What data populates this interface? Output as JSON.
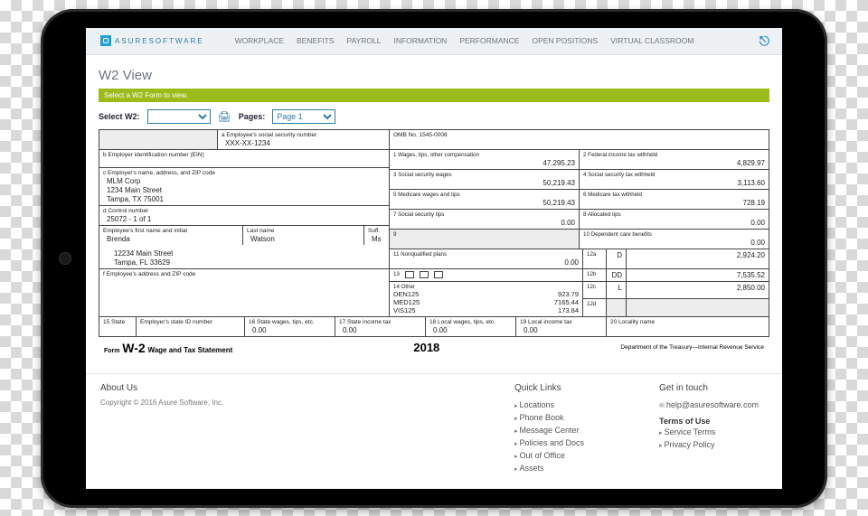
{
  "brand": {
    "name": "ASURESOFTWARE"
  },
  "nav": {
    "items": [
      "WORKPLACE",
      "BENEFITS",
      "PAYROLL",
      "INFORMATION",
      "PERFORMANCE",
      "OPEN POSITIONS",
      "VIRTUAL CLASSROOM"
    ]
  },
  "page": {
    "title": "W2 View",
    "green_bar": "Select a W2 Form to view.",
    "select_w2_label": "Select W2:",
    "select_w2_value": "",
    "pages_label": "Pages:",
    "pages_value": "Page 1"
  },
  "w2": {
    "box_a_label": "a Employee's social security number",
    "box_a_value": "XXX-XX-1234",
    "omb": "OMB No. 1545-0008",
    "box_b_label": "b Employer identification number (EIN)",
    "box_c_label": "c Employer's name, address, and ZIP code",
    "employer": {
      "name": "MLM Corp",
      "addr1": "1234 Main Street",
      "addr2": "Tampa, TX 75001"
    },
    "box_d_label": "d Control number",
    "box_d_value": "25072 - 1 of 1",
    "emp_first_label": "Employee's first name and initial",
    "emp_last_label": "Last name",
    "emp_suffix_label": "Suff.",
    "employee": {
      "first": "Brenda",
      "last": "Watson",
      "suffix": "Ms",
      "addr1": "12234 Main Street",
      "addr2": "Tampa, FL 33629"
    },
    "emp_addr_label": "f Employee's address and ZIP code",
    "box1_label": "1 Wages, tips, other compensation",
    "box1": "47,295.23",
    "box2_label": "2 Federal income tax withheld",
    "box2": "4,829.97",
    "box3_label": "3 Social security wages",
    "box3": "50,219.43",
    "box4_label": "4 Social security tax withheld",
    "box4": "3,113.60",
    "box5_label": "5 Medicare wages and tips",
    "box5": "50,219.43",
    "box6_label": "6 Medicare tax withheld",
    "box6": "728.19",
    "box7_label": "7 Social security tips",
    "box7": "0.00",
    "box8_label": "8 Allocated tips",
    "box8": "0.00",
    "box9_label": "9",
    "box9": "",
    "box10_label": "10 Dependent care benefits",
    "box10": "0.00",
    "box11_label": "11 Nonqualified plans",
    "box11": "0.00",
    "box12a_label": "12a",
    "box12a_code": "D",
    "box12a": "2,924.20",
    "box12b_label": "12b",
    "box12b_code": "DD",
    "box12b": "7,535.52",
    "box12c_label": "12c",
    "box12c_code": "L",
    "box12c": "2,850.00",
    "box12d_label": "12d",
    "box12d_code": "",
    "box12d": "",
    "box13_label": "13",
    "box14_label": "14 Other",
    "box14": [
      {
        "code": "DEN125",
        "amt": "923.79"
      },
      {
        "code": "MED125",
        "amt": "7165.44"
      },
      {
        "code": "VIS125",
        "amt": "173.84"
      }
    ],
    "box15_label": "15 State",
    "box15_id_label": "Employer's state ID number",
    "box16_label": "16 State wages, tips, etc.",
    "box16": "0.00",
    "box17_label": "17 State income tax",
    "box17": "0.00",
    "box18_label": "18 Local wages, tips, etc.",
    "box18": "0.00",
    "box19_label": "19 Local income tax",
    "box19": "0.00",
    "box20_label": "20 Locality name",
    "form_name": "W-2",
    "form_desc": "Wage and Tax Statement",
    "year": "2018",
    "treasury": "Department of the Treasury—Internal Revenue Service"
  },
  "footer": {
    "about_h": "About Us",
    "about_copy": "Copyright © 2016  Asure Software, Inc.",
    "quick_h": "Quick Links",
    "quick": [
      "Locations",
      "Phone Book",
      "Message Center",
      "Policies and Docs",
      "Out of Office",
      "Assets"
    ],
    "contact_h": "Get in touch",
    "contact_email": "help@asuresoftware.com",
    "terms_h": "Terms of Use",
    "terms": [
      "Service Terms",
      "Privacy Policy"
    ]
  }
}
